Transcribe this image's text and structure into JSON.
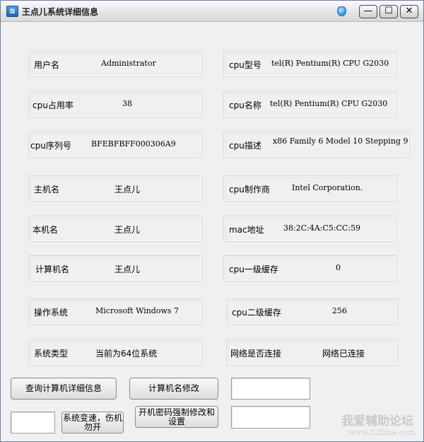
{
  "window": {
    "title": "王点儿系统详细信息",
    "icon": "app-icon",
    "controls": [
      "—",
      "☐",
      "✕"
    ]
  },
  "left_fields": [
    {
      "label": "用户名",
      "value": "Administrator"
    },
    {
      "label": "cpu占用率",
      "value": "38"
    },
    {
      "label": "cpu序列号",
      "value": "BFEBFBFF000306A9"
    },
    {
      "label": "主机名",
      "value": "王点儿"
    },
    {
      "label": "本机名",
      "value": "王点儿"
    },
    {
      "label": "计算机名",
      "value": "王点儿"
    },
    {
      "label": "操作系统",
      "value": "Microsoft Windows 7"
    },
    {
      "label": "系统类型",
      "value": "当前为64位系统"
    }
  ],
  "right_fields": [
    {
      "label": "cpu型号",
      "value": "tel(R) Pentium(R) CPU G2030"
    },
    {
      "label": "cpu名称",
      "value": "tel(R) Pentium(R) CPU G2030"
    },
    {
      "label": "cpu描述",
      "value": "x86 Family 6 Model 10 Stepping 9"
    },
    {
      "label": "cpu制作商",
      "value": "Intel Corporation."
    },
    {
      "label": "mac地址",
      "value": "38:2C:4A:C5:CC:59"
    },
    {
      "label": "cpu一级缓存",
      "value": "0"
    },
    {
      "label": "cpu二级缓存",
      "value": "256"
    },
    {
      "label": "网络是否连接",
      "value": "网络已连接"
    }
  ],
  "buttons": {
    "query_details": "查询计算机详细信息",
    "rename_computer": "计算机名修改",
    "speed_up_line1": "系统变速，伤机",
    "speed_up_line2": "勿开",
    "boot_password_line1": "开机密码强制修改和",
    "boot_password_line2": "设置"
  },
  "inputs": {
    "rename_value": "",
    "speed_value": "",
    "password_value": ""
  },
  "watermark": {
    "line1": "我爱辅助论坛",
    "line2": "www.52fzba.com"
  }
}
